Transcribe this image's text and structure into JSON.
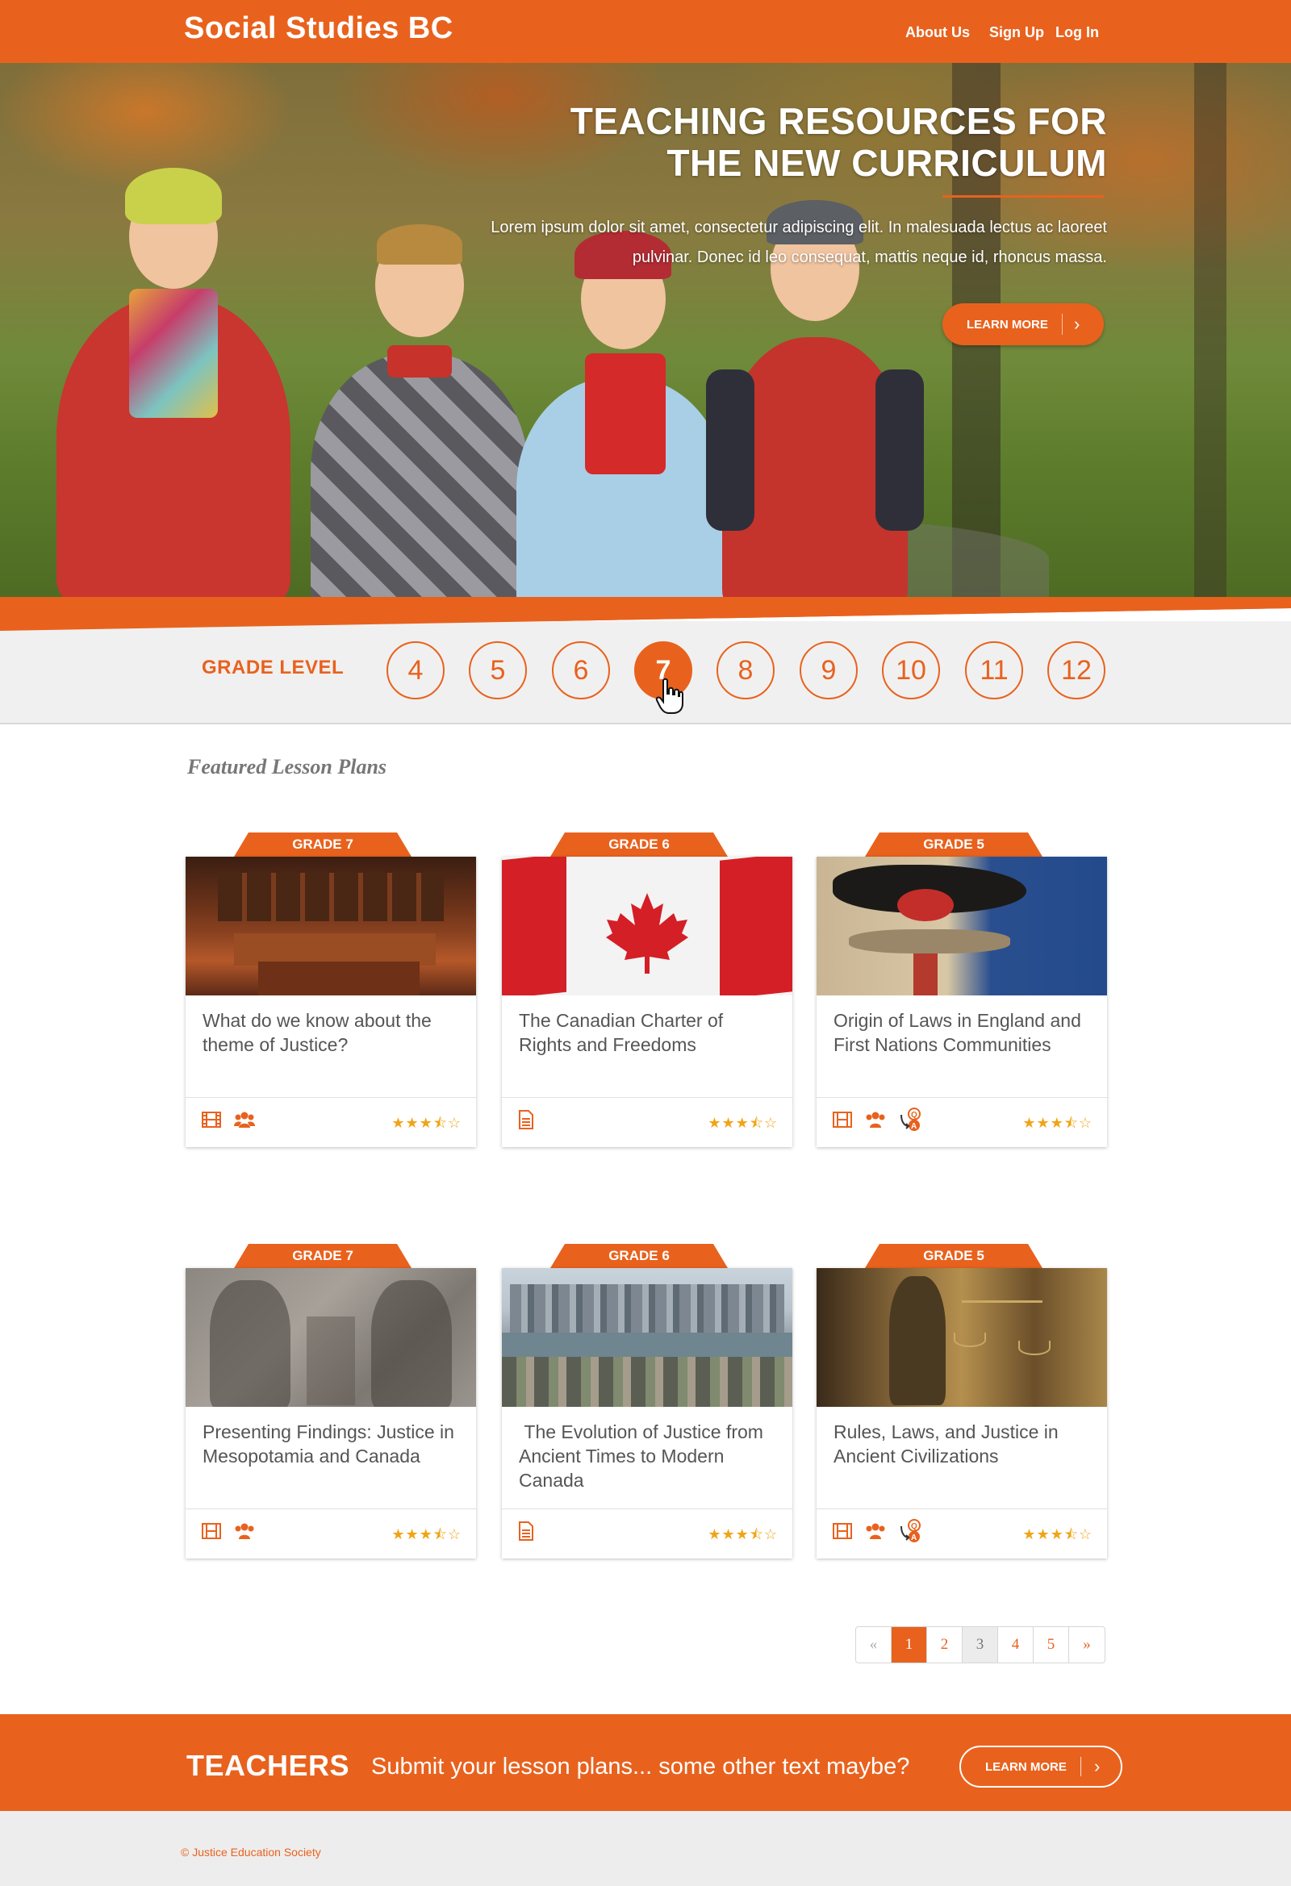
{
  "header": {
    "brand": "Social Studies BC",
    "nav": [
      "About Us",
      "Sign Up",
      "Log In"
    ]
  },
  "hero": {
    "title_line1": "TEACHING RESOURCES FOR",
    "title_line2": "THE NEW CURRICULUM",
    "text_line1": "Lorem ipsum dolor sit amet, consectetur adipiscing elit. In malesuada lectus ac laoreet",
    "text_line2": "pulvinar. Donec id leo consequat, mattis neque id, rhoncus massa.",
    "button": "LEARN MORE"
  },
  "grade_level": {
    "label": "GRADE LEVEL",
    "grades": [
      "4",
      "5",
      "6",
      "7",
      "8",
      "9",
      "10",
      "11",
      "12"
    ],
    "selected": "7"
  },
  "featured": {
    "title": "Featured Lesson Plans",
    "cards": [
      {
        "grade": "GRADE 7",
        "title": "What do we know about the theme of Justice?",
        "icons": [
          "film-icon",
          "group-icon"
        ],
        "rating": 3.5
      },
      {
        "grade": "GRADE 6",
        "title": "The Canadian Charter of Rights and Freedoms",
        "icons": [
          "document-icon"
        ],
        "rating": 3.5
      },
      {
        "grade": "GRADE 5",
        "title": "Origin of Laws in England and First Nations Communities",
        "icons": [
          "film-icon",
          "group-icon",
          "qa-icon"
        ],
        "rating": 3.5
      },
      {
        "grade": "GRADE 7",
        "title": "Presenting Findings: Justice in Mesopotamia and Canada",
        "icons": [
          "film-icon",
          "group-icon"
        ],
        "rating": 3.5
      },
      {
        "grade": "GRADE 6",
        "title": " The Evolution of Justice from Ancient Times to Modern Canada",
        "icons": [
          "document-icon"
        ],
        "rating": 3.5
      },
      {
        "grade": "GRADE 5",
        "title": "Rules, Laws, and Justice in Ancient Civilizations",
        "icons": [
          "film-icon",
          "group-icon",
          "qa-icon"
        ],
        "rating": 3.5
      }
    ]
  },
  "pagination": {
    "prev": "«",
    "pages": [
      "1",
      "2",
      "3",
      "4",
      "5"
    ],
    "next": "»",
    "current": "1"
  },
  "teachers": {
    "label": "TEACHERS",
    "text": "Submit your lesson plans... some other text maybe?",
    "button": "LEARN MORE"
  },
  "footer": {
    "copyright": "© Justice Education Society"
  },
  "colors": {
    "accent": "#e8621e",
    "star": "#f1a417",
    "footer_bg": "#eeeded"
  }
}
